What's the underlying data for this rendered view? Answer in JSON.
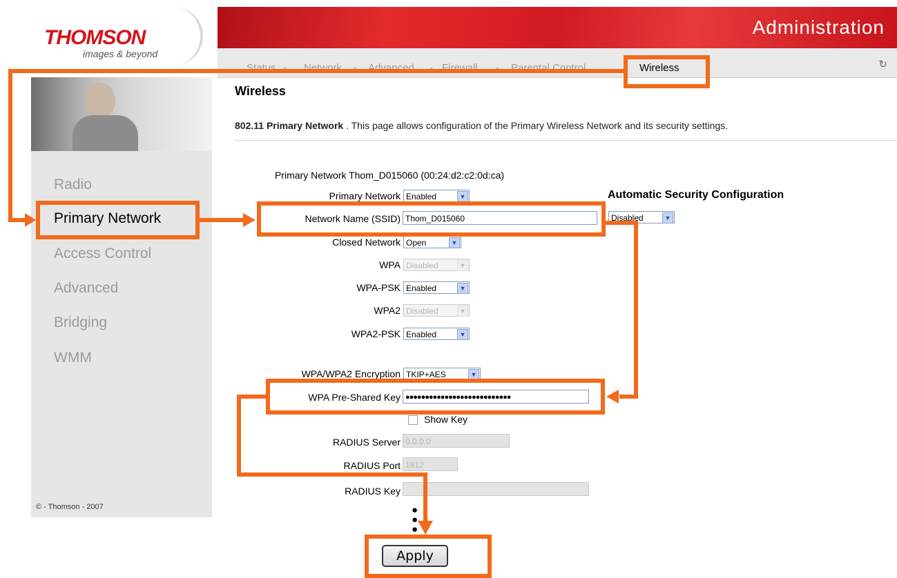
{
  "header": {
    "brand": "THOMSON",
    "tagline": "images & beyond",
    "title": "Administration"
  },
  "nav": {
    "items": [
      "Status",
      "Network",
      "Advanced",
      "Firewall",
      "Parental Control",
      "Wireless"
    ],
    "active": "Wireless",
    "refresh_icon": "refresh-icon"
  },
  "sidebar": {
    "items": [
      {
        "label": "Radio"
      },
      {
        "label": "Primary Network"
      },
      {
        "label": "Access Control"
      },
      {
        "label": "Advanced"
      },
      {
        "label": "Bridging"
      },
      {
        "label": "WMM"
      }
    ],
    "copyright": "© - Thomson - 2007"
  },
  "page": {
    "title": "Wireless",
    "desc_bold": "802.11 Primary Network",
    "desc_rest": " .  This page allows configuration of the Primary Wireless Network and its security settings."
  },
  "form": {
    "network_info": "Primary Network Thom_D015060 (00:24:d2:c2:0d:ca)",
    "primary_network": {
      "label": "Primary Network",
      "value": "Enabled"
    },
    "auto_security": {
      "label": "Automatic Security Configuration",
      "value": "Disabled"
    },
    "ssid": {
      "label": "Network Name (SSID)",
      "value": "Thom_D015060"
    },
    "closed_network": {
      "label": "Closed Network",
      "value": "Open"
    },
    "wpa": {
      "label": "WPA",
      "value": "Disabled"
    },
    "wpa_psk": {
      "label": "WPA-PSK",
      "value": "Enabled"
    },
    "wpa2": {
      "label": "WPA2",
      "value": "Disabled"
    },
    "wpa2_psk": {
      "label": "WPA2-PSK",
      "value": "Enabled"
    },
    "encryption": {
      "label": "WPA/WPA2 Encryption",
      "value": "TKIP+AES"
    },
    "psk": {
      "label": "WPA Pre-Shared Key",
      "value": "●●●●●●●●●●●●●●●●●●●●●●●●●●●"
    },
    "show_key": {
      "label": "Show Key"
    },
    "radius_server": {
      "label": "RADIUS Server",
      "value": "0.0.0.0"
    },
    "radius_port": {
      "label": "RADIUS Port",
      "value": "1812"
    },
    "radius_key": {
      "label": "RADIUS Key",
      "value": ""
    },
    "apply": "Apply"
  },
  "colors": {
    "annotation": "#f26a1b",
    "header_red": "#d21a22",
    "sidebar_bg": "#e6e6e6"
  }
}
